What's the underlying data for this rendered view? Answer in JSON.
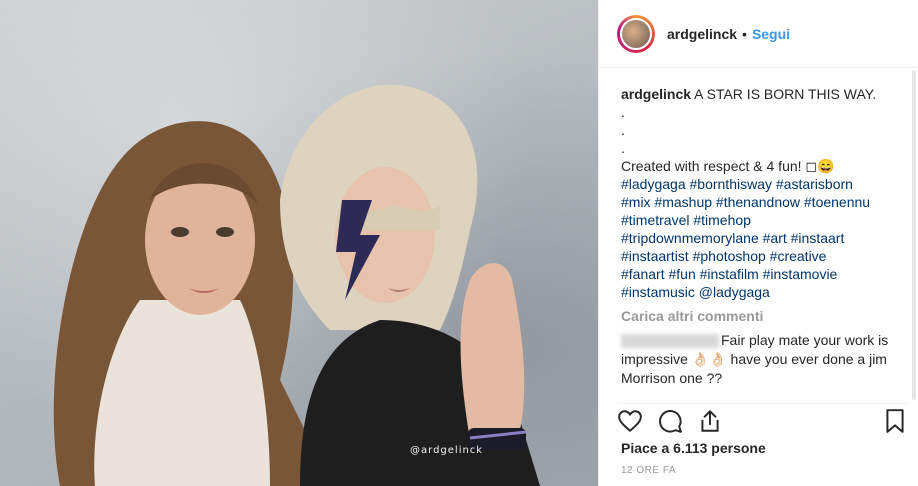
{
  "header": {
    "username": "ardgelinck",
    "separator": "•",
    "follow_label": "Segui"
  },
  "media": {
    "watermark": "@ardgelinck"
  },
  "caption": {
    "username": "ardgelinck",
    "title": "A STAR IS BORN THIS WAY.",
    "dots": [
      ".",
      ".",
      "."
    ],
    "text": "Created with respect & 4 fun! ◻😄",
    "hashtag_lines": [
      "#ladygaga #bornthisway #astarisborn",
      "#mix #mashup #thenandnow #toenennu",
      "#timetravel #timehop",
      "#tripdownmemorylane #art #instaart",
      "#instaartist #photoshop #creative",
      "#fanart #fun #instafilm #instamovie",
      "#instamusic @ladygaga"
    ]
  },
  "comments": {
    "load_more": "Carica altri commenti",
    "first": {
      "text": "Fair play mate your work is impressive 👌🏻👌🏻 have you ever done a jim Morrison one ??"
    }
  },
  "footer": {
    "likes": "Piace a 6.113 persone",
    "time": "12 ORE FA"
  },
  "icons": [
    "heart-icon",
    "comment-icon",
    "share-icon",
    "bookmark-icon"
  ]
}
